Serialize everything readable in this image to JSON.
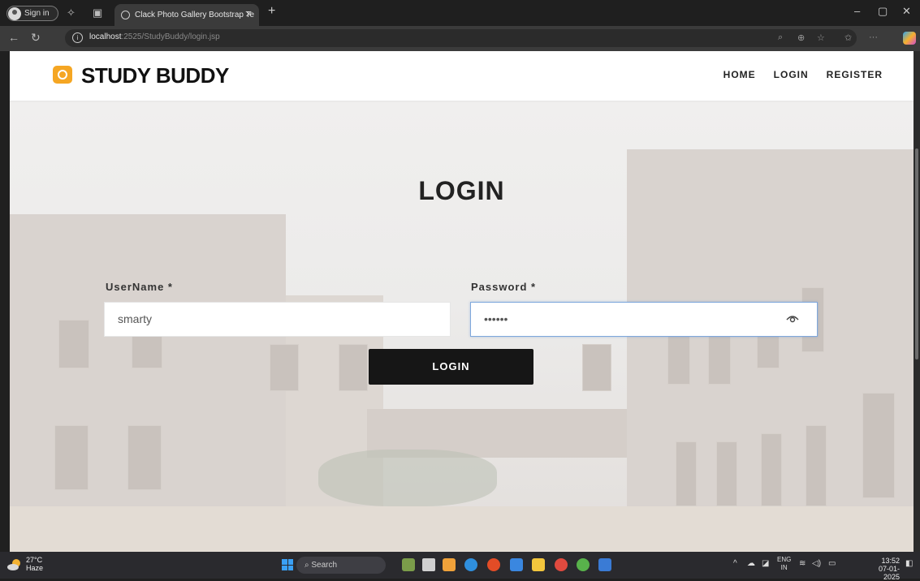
{
  "browser": {
    "profile_label": "Sign in",
    "tab_title": "Clack Photo Gallery Bootstrap Te",
    "url_host": "localhost",
    "url_rest": ":2525/StudyBuddy/login.jsp"
  },
  "navbar": {
    "brand": "STUDY BUDDY",
    "links": [
      "HOME",
      "LOGIN",
      "REGISTER"
    ]
  },
  "login": {
    "title": "LOGIN",
    "username_label": "UserName *",
    "username_value": "smarty",
    "password_label": "Password *",
    "password_value": "••••••",
    "submit_label": "LOGIN"
  },
  "taskbar": {
    "temp": "27°C",
    "weather": "Haze",
    "search": "Search",
    "lang1": "ENG",
    "lang2": "IN",
    "time": "13:52",
    "date": "07-01-2025"
  }
}
